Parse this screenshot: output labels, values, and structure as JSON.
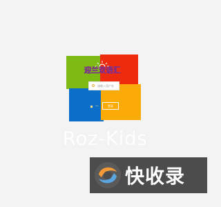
{
  "app": {
    "logo_text": "迎兰双语汇"
  },
  "login_form": {
    "username_placeholder": "请输入用户名",
    "captcha_text": "■ 一",
    "login_label": "登录"
  },
  "brand": {
    "name": "Roz-Kids"
  },
  "watermark": {
    "app_name": "快收录"
  },
  "colors": {
    "green": "#7dba13",
    "red": "#ef2b0e",
    "blue": "#0b6ec8",
    "orange": "#fbab07",
    "watermark_bg": "#4c4c4c"
  }
}
